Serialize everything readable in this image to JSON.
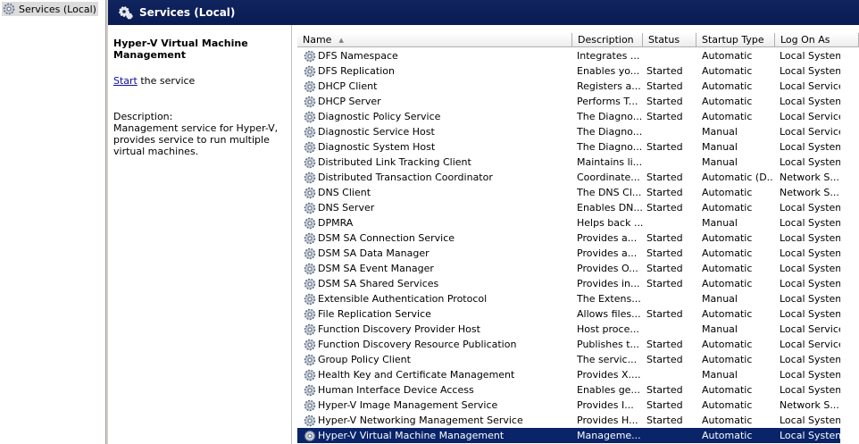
{
  "tree": {
    "item_label": "Services (Local)"
  },
  "header": {
    "title": "Services (Local)"
  },
  "description_pane": {
    "service_title": "Hyper-V Virtual Machine Management",
    "start_link": "Start",
    "start_suffix": " the service",
    "description_label": "Description:",
    "description_text": "Management service for Hyper-V, provides service to run multiple virtual machines."
  },
  "columns": {
    "name": "Name",
    "description": "Description",
    "status": "Status",
    "startup_type": "Startup Type",
    "log_on_as": "Log On As"
  },
  "rows": [
    {
      "name": "DFS Namespace",
      "desc": "Integrates ...",
      "status": "",
      "type": "Automatic",
      "logon": "Local System"
    },
    {
      "name": "DFS Replication",
      "desc": "Enables yo...",
      "status": "Started",
      "type": "Automatic",
      "logon": "Local System"
    },
    {
      "name": "DHCP Client",
      "desc": "Registers a...",
      "status": "Started",
      "type": "Automatic",
      "logon": "Local Service"
    },
    {
      "name": "DHCP Server",
      "desc": "Performs T...",
      "status": "Started",
      "type": "Automatic",
      "logon": "Local System"
    },
    {
      "name": "Diagnostic Policy Service",
      "desc": "The Diagno...",
      "status": "Started",
      "type": "Automatic",
      "logon": "Local Service"
    },
    {
      "name": "Diagnostic Service Host",
      "desc": "The Diagno...",
      "status": "",
      "type": "Manual",
      "logon": "Local Service"
    },
    {
      "name": "Diagnostic System Host",
      "desc": "The Diagno...",
      "status": "Started",
      "type": "Manual",
      "logon": "Local System"
    },
    {
      "name": "Distributed Link Tracking Client",
      "desc": "Maintains li...",
      "status": "",
      "type": "Manual",
      "logon": "Local System"
    },
    {
      "name": "Distributed Transaction Coordinator",
      "desc": "Coordinate...",
      "status": "Started",
      "type": "Automatic (D...",
      "logon": "Network S..."
    },
    {
      "name": "DNS Client",
      "desc": "The DNS Cl...",
      "status": "Started",
      "type": "Automatic",
      "logon": "Network S..."
    },
    {
      "name": "DNS Server",
      "desc": "Enables DN...",
      "status": "Started",
      "type": "Automatic",
      "logon": "Local System"
    },
    {
      "name": "DPMRA",
      "desc": "Helps back ...",
      "status": "",
      "type": "Manual",
      "logon": "Local System"
    },
    {
      "name": "DSM SA Connection Service",
      "desc": "Provides a...",
      "status": "Started",
      "type": "Automatic",
      "logon": "Local System"
    },
    {
      "name": "DSM SA Data Manager",
      "desc": "Provides a...",
      "status": "Started",
      "type": "Automatic",
      "logon": "Local System"
    },
    {
      "name": "DSM SA Event Manager",
      "desc": "Provides O...",
      "status": "Started",
      "type": "Automatic",
      "logon": "Local System"
    },
    {
      "name": "DSM SA Shared Services",
      "desc": "Provides in...",
      "status": "Started",
      "type": "Automatic",
      "logon": "Local System"
    },
    {
      "name": "Extensible Authentication Protocol",
      "desc": "The Extens...",
      "status": "",
      "type": "Manual",
      "logon": "Local System"
    },
    {
      "name": "File Replication Service",
      "desc": "Allows files...",
      "status": "Started",
      "type": "Automatic",
      "logon": "Local System"
    },
    {
      "name": "Function Discovery Provider Host",
      "desc": "Host proce...",
      "status": "",
      "type": "Manual",
      "logon": "Local Service"
    },
    {
      "name": "Function Discovery Resource Publication",
      "desc": "Publishes t...",
      "status": "Started",
      "type": "Automatic",
      "logon": "Local Service"
    },
    {
      "name": "Group Policy Client",
      "desc": "The servic...",
      "status": "Started",
      "type": "Automatic",
      "logon": "Local System"
    },
    {
      "name": "Health Key and Certificate Management",
      "desc": "Provides X....",
      "status": "",
      "type": "Manual",
      "logon": "Local System"
    },
    {
      "name": "Human Interface Device Access",
      "desc": "Enables ge...",
      "status": "Started",
      "type": "Automatic",
      "logon": "Local System"
    },
    {
      "name": "Hyper-V Image Management Service",
      "desc": "Provides I...",
      "status": "Started",
      "type": "Automatic",
      "logon": "Network S..."
    },
    {
      "name": "Hyper-V Networking Management Service",
      "desc": "Provides H...",
      "status": "Started",
      "type": "Automatic",
      "logon": "Local System"
    },
    {
      "name": "Hyper-V Virtual Machine Management",
      "desc": "Manageme...",
      "status": "",
      "type": "Automatic",
      "logon": "Local System",
      "selected": true
    }
  ]
}
